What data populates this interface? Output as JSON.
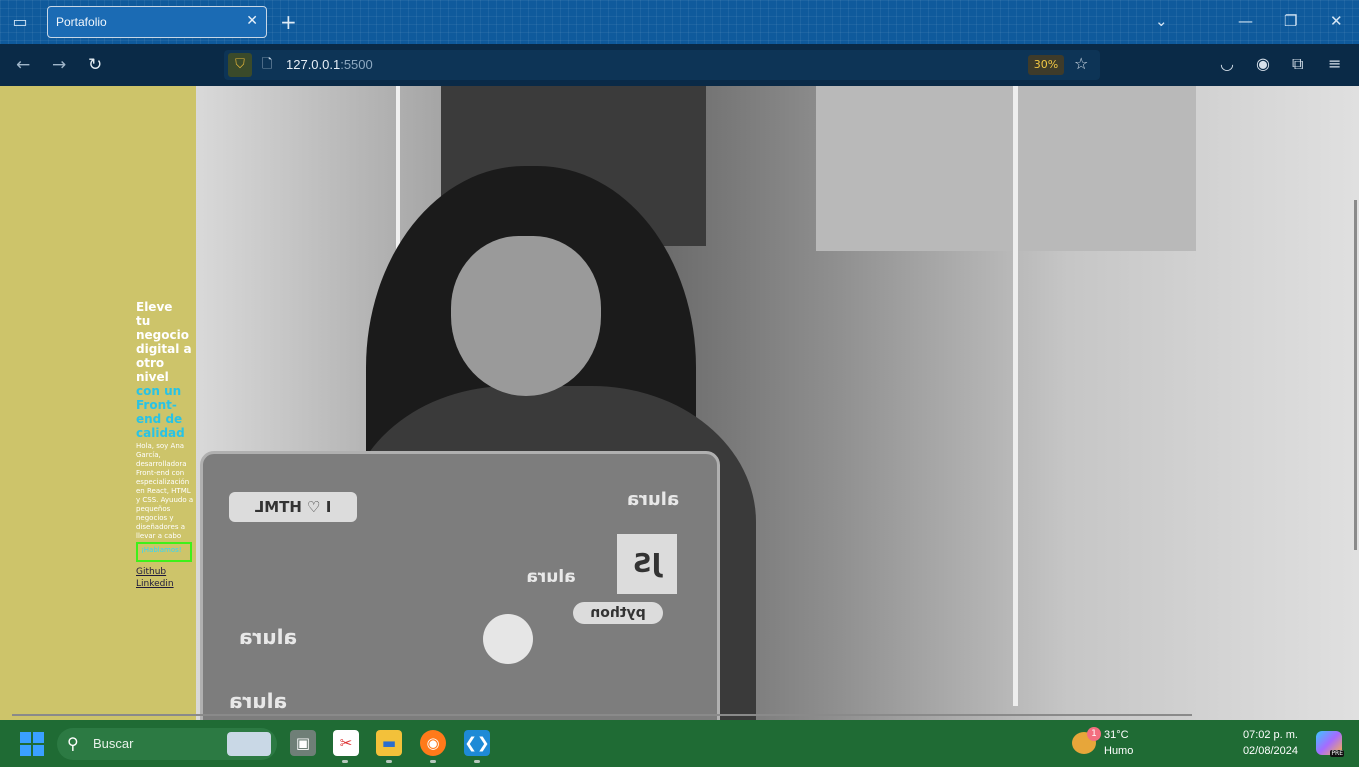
{
  "browser": {
    "tab_title": "Portafolio",
    "tab_close": "✕",
    "new_tab": "+",
    "url_host": "127.0.0.1",
    "url_port": ":5500",
    "zoom": "30%"
  },
  "hero": {
    "heading_white": [
      "Eleve",
      "tu",
      "negocio",
      "digital a",
      "otro",
      "nivel"
    ],
    "heading_cyan": [
      "con un",
      "Front-",
      "end de",
      "calidad"
    ],
    "intro": "Hola, soy Ana García, desarrolladora Front-end con especialización en React, HTML y CSS. Ayuudo a pequeños negocios y diseñadores a llevar a cabo",
    "cta": "¡Hablamos!",
    "links": [
      "Github",
      "Linkedin"
    ]
  },
  "photo": {
    "stickers": [
      "I ♡ HTML",
      "alura",
      "alura",
      "alura",
      "alura",
      "python",
      "JS"
    ]
  },
  "taskbar": {
    "search_placeholder": "Buscar",
    "weather_badge": "1",
    "temperature": "31°C",
    "condition": "Humo",
    "time": "07:02 p. m.",
    "date": "02/08/2024",
    "copilot_badge": "PRE"
  },
  "colors": {
    "page_bg": "#cdc46a",
    "heading_cyan": "#28c3e6",
    "cta_border": "#3ef01a",
    "tabbar": "#0f5a9c",
    "taskbar": "#1f6b34"
  }
}
